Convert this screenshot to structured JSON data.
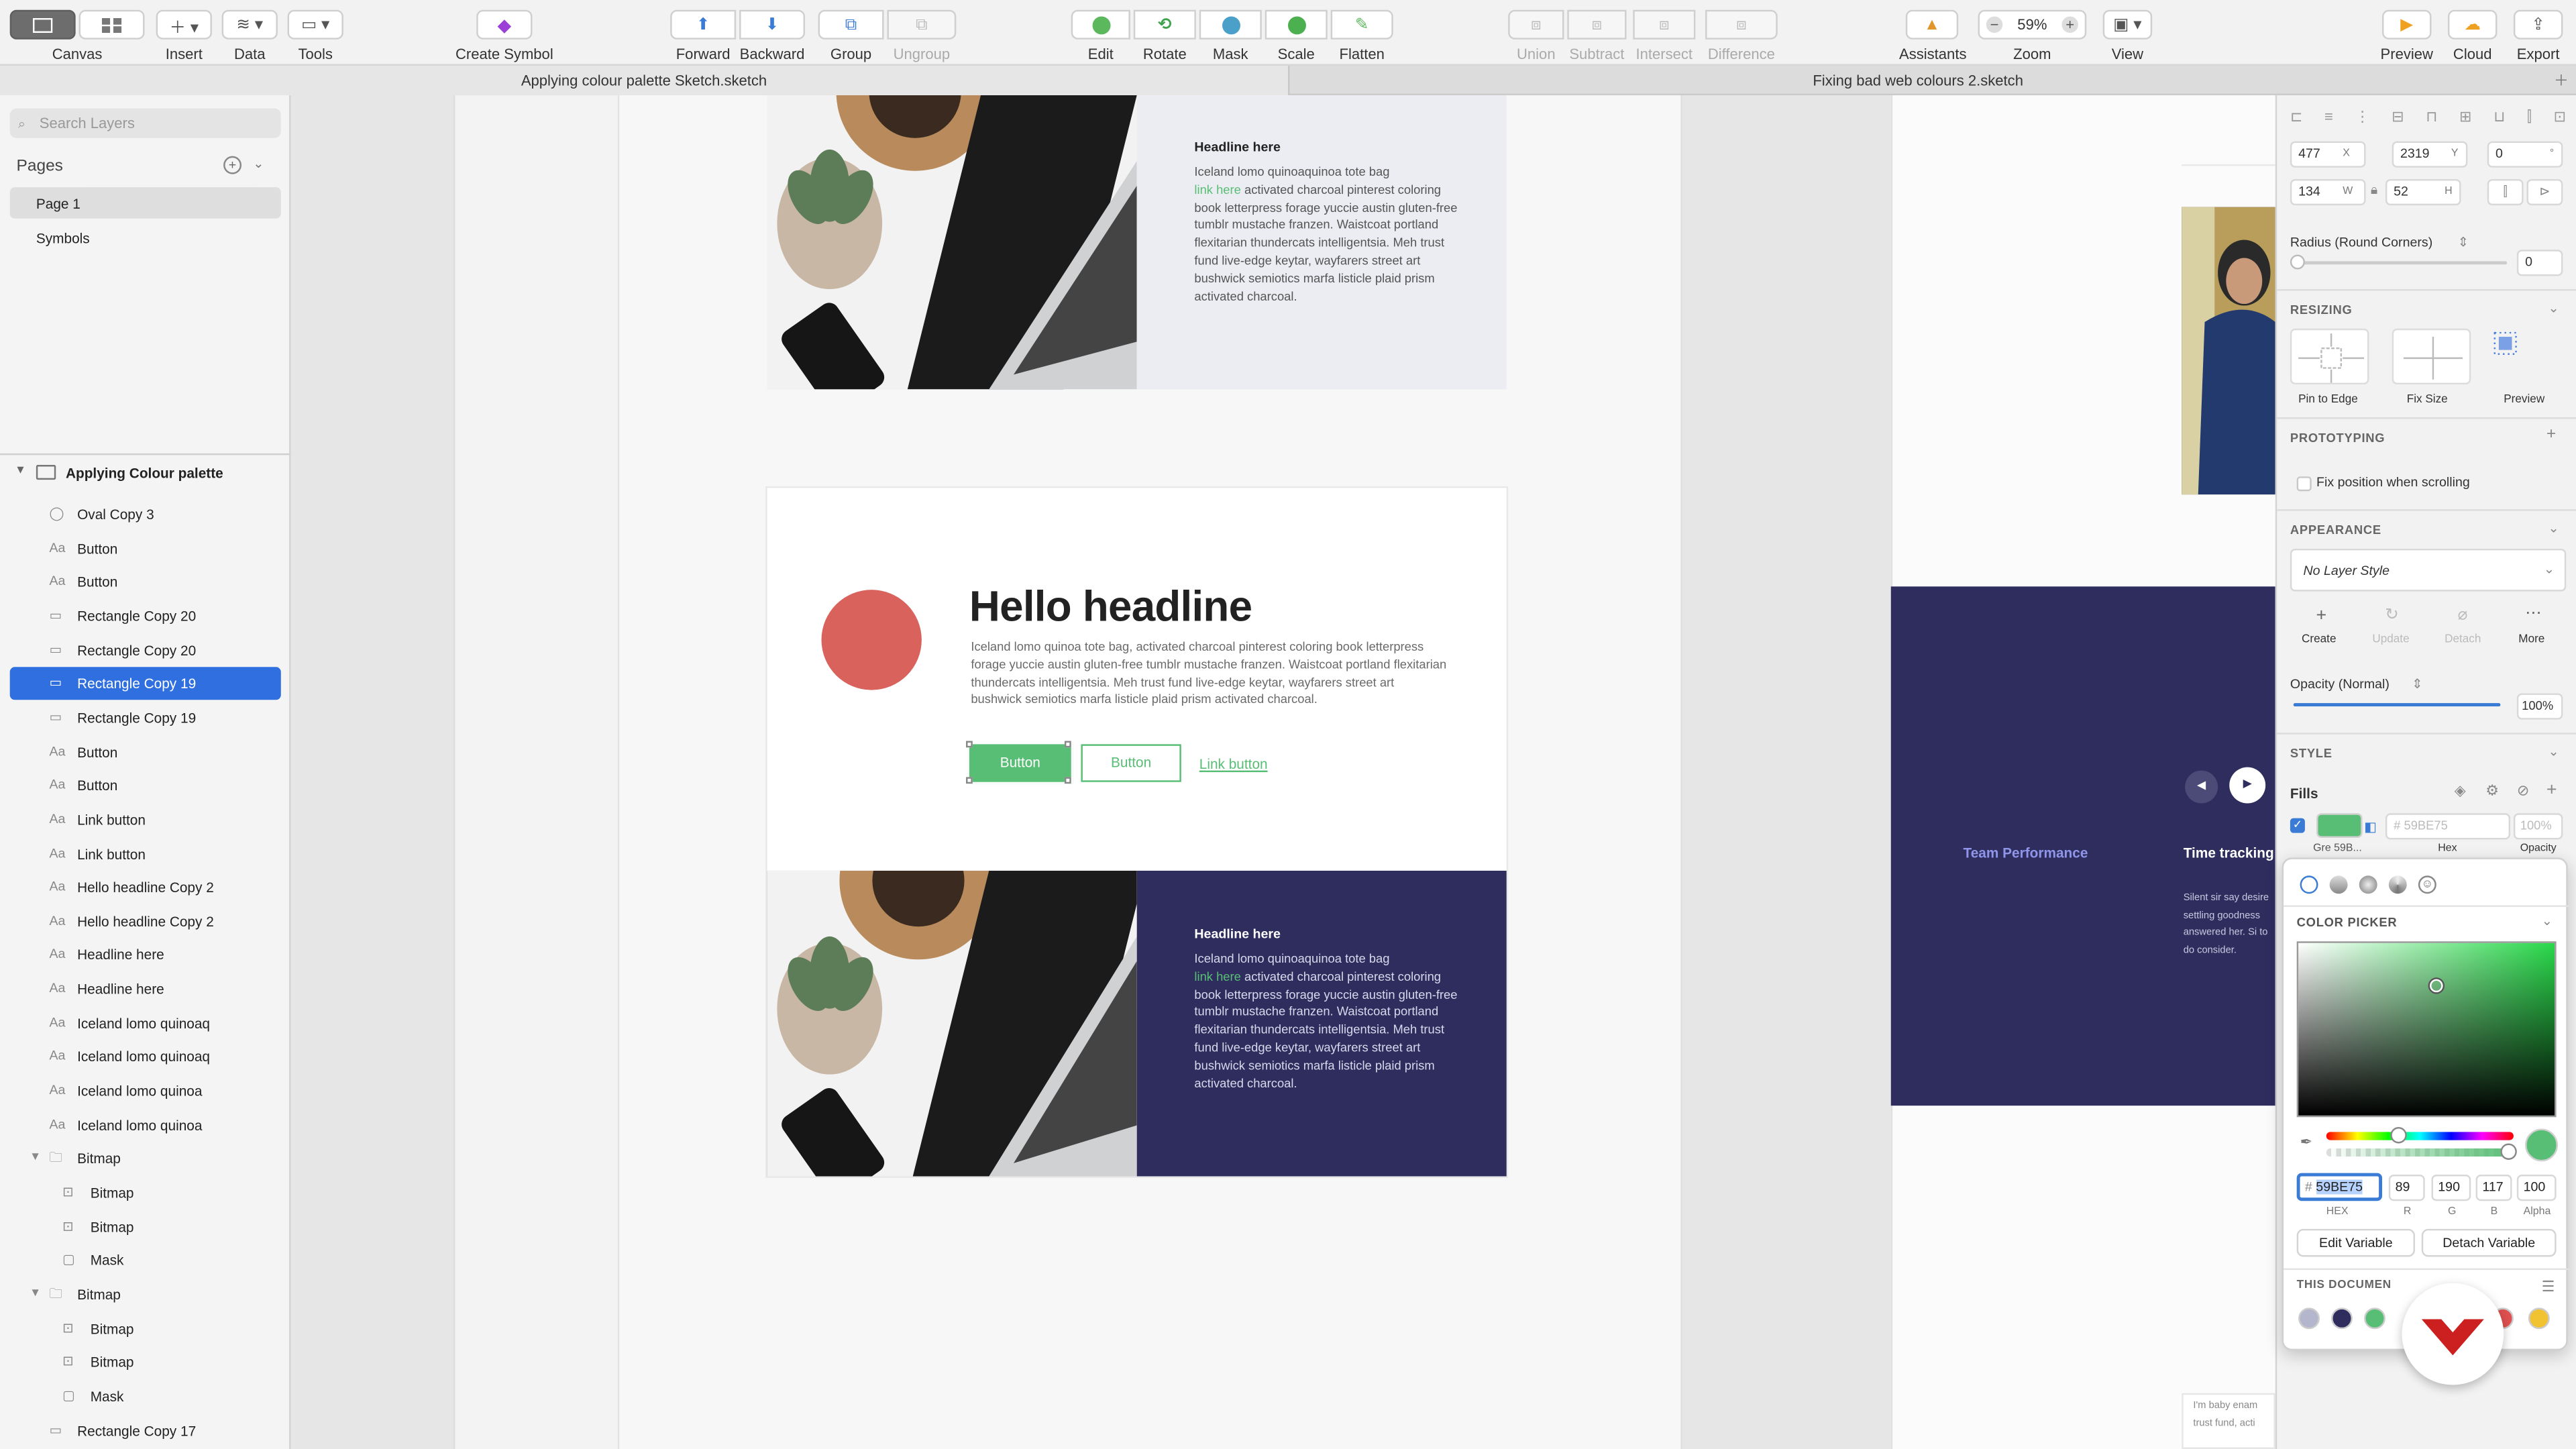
{
  "toolbar": {
    "canvas": "Canvas",
    "insert": "Insert",
    "data": "Data",
    "tools": "Tools",
    "create_symbol": "Create Symbol",
    "forward": "Forward",
    "backward": "Backward",
    "group": "Group",
    "ungroup": "Ungroup",
    "edit": "Edit",
    "rotate": "Rotate",
    "mask": "Mask",
    "scale": "Scale",
    "flatten": "Flatten",
    "union": "Union",
    "subtract": "Subtract",
    "intersect": "Intersect",
    "difference": "Difference",
    "assistants": "Assistants",
    "zoom": "Zoom",
    "zoom_value": "59%",
    "view": "View",
    "preview": "Preview",
    "cloud": "Cloud",
    "export": "Export"
  },
  "tabs": [
    "Applying colour palette Sketch.sketch",
    "Fixing bad web colours 2.sketch"
  ],
  "left": {
    "search_placeholder": "Search Layers",
    "pages_title": "Pages",
    "pages": [
      "Page 1",
      "Symbols"
    ],
    "artboard": "Applying Colour palette",
    "layers": [
      {
        "name": "Oval Copy 3",
        "icon": "oval-icon",
        "indent": 0
      },
      {
        "name": "Button",
        "icon": "text-icon",
        "indent": 0
      },
      {
        "name": "Button",
        "icon": "text-icon",
        "indent": 0
      },
      {
        "name": "Rectangle Copy 20",
        "icon": "rectangle-icon",
        "indent": 0
      },
      {
        "name": "Rectangle Copy 20",
        "icon": "rectangle-icon",
        "indent": 0
      },
      {
        "name": "Rectangle Copy 19",
        "icon": "rectangle-icon",
        "indent": 0,
        "selected": true
      },
      {
        "name": "Rectangle Copy 19",
        "icon": "rectangle-icon",
        "indent": 0
      },
      {
        "name": "Button",
        "icon": "text-icon",
        "indent": 0
      },
      {
        "name": "Button",
        "icon": "text-icon",
        "indent": 0
      },
      {
        "name": "Link button",
        "icon": "text-icon",
        "indent": 0
      },
      {
        "name": "Link button",
        "icon": "text-icon",
        "indent": 0
      },
      {
        "name": "Hello headline Copy 2",
        "icon": "text-icon",
        "indent": 0
      },
      {
        "name": "Hello headline Copy 2",
        "icon": "text-icon",
        "indent": 0
      },
      {
        "name": "Headline here",
        "icon": "text-icon",
        "indent": 0
      },
      {
        "name": "Headline here",
        "icon": "text-icon",
        "indent": 0
      },
      {
        "name": "Iceland lomo quinoaq",
        "icon": "text-icon",
        "indent": 0
      },
      {
        "name": "Iceland lomo quinoaq",
        "icon": "text-icon",
        "indent": 0
      },
      {
        "name": "Iceland lomo quinoa",
        "icon": "text-icon",
        "indent": 0
      },
      {
        "name": "Iceland lomo quinoa",
        "icon": "text-icon",
        "indent": 0
      },
      {
        "name": "Bitmap",
        "icon": "folder-icon",
        "indent": 0,
        "group": true
      },
      {
        "name": "Bitmap",
        "icon": "bitmap-icon",
        "indent": 1
      },
      {
        "name": "Bitmap",
        "icon": "bitmap-icon",
        "indent": 1
      },
      {
        "name": "Mask",
        "icon": "mask-icon",
        "indent": 1
      },
      {
        "name": "Bitmap",
        "icon": "folder-icon",
        "indent": 0,
        "group": true
      },
      {
        "name": "Bitmap",
        "icon": "bitmap-icon",
        "indent": 1
      },
      {
        "name": "Bitmap",
        "icon": "bitmap-icon",
        "indent": 1
      },
      {
        "name": "Mask",
        "icon": "mask-icon",
        "indent": 1
      },
      {
        "name": "Rectangle Copy 17",
        "icon": "rectangle-icon",
        "indent": 0
      }
    ]
  },
  "canvas": {
    "headline_small": "Headline here",
    "link_here": "link here",
    "body_lines_1": "Iceland lomo quinoaquinoa tote bag",
    "body_rest": "activated charcoal pinterest coloring book letterpress forage yuccie austin gluten-free tumblr mustache franzen. Waistcoat portland flexitarian thundercats intelligentsia. Meh trust fund live-edge keytar, wayfarers street art bushwick semiotics marfa listicle plaid prism activated charcoal.",
    "hello_headline": "Hello headline",
    "hello_body": "Iceland lomo quinoa tote bag, activated charcoal pinterest coloring book letterpress forage yuccie austin gluten-free tumblr mustache franzen. Waistcoat portland flexitarian thundercats intelligentsia. Meh trust fund live-edge keytar, wayfarers street art bushwick semiotics marfa listicle plaid prism activated charcoal.",
    "button_primary": "Button",
    "button_secondary": "Button",
    "link_button": "Link button",
    "team_performance": "Team Performance",
    "time_tracking": "Time tracking",
    "side_para": "Silent sir say desire settling goodness answered her. Si to do consider.",
    "baby_para": "I'm baby enam trust fund, acti"
  },
  "inspector": {
    "x": "477",
    "x_label": "X",
    "y": "2319",
    "y_label": "Y",
    "rot": "0",
    "rot_label": "°",
    "w": "134",
    "w_label": "W",
    "h": "52",
    "h_label": "H",
    "radius_label": "Radius (Round Corners)",
    "radius": "0",
    "resizing": "RESIZING",
    "pin_to_edge": "Pin to Edge",
    "fix_size": "Fix Size",
    "preview": "Preview",
    "prototyping": "PROTOTYPING",
    "fix_position": "Fix position when scrolling",
    "appearance": "APPEARANCE",
    "layer_style": "No Layer Style",
    "create": "Create",
    "update": "Update",
    "detach": "Detach",
    "more": "More",
    "opacity_label": "Opacity (Normal)",
    "opacity": "100%",
    "opacity_fraction": 1.0,
    "style": "STYLE",
    "fills": "Fills",
    "fill_hex": "# 59BE75",
    "fill_opacity": "100%",
    "fill_name": "Gre",
    "fill_name_hex": "59B...",
    "hex_label": "Hex",
    "opacity_col_label": "Opacity"
  },
  "picker": {
    "title": "COLOR PICKER",
    "hex": "59BE75",
    "r": "89",
    "g": "190",
    "b": "117",
    "alpha": "100",
    "hex_label": "HEX",
    "r_label": "R",
    "g_label": "G",
    "b_label": "B",
    "alpha_label": "Alpha",
    "edit_variable": "Edit Variable",
    "detach_variable": "Detach Variable",
    "this_document": "THIS DOCUMEN",
    "swatches": [
      "#b3b6cc",
      "#2e2d5e",
      "#59be75",
      "#e05050",
      "#f1c232"
    ]
  },
  "colors": {
    "accent_green": "#59be75",
    "navy": "#2e2d5e",
    "coral": "#d9625c",
    "selection_blue": "#2f6fe0"
  }
}
